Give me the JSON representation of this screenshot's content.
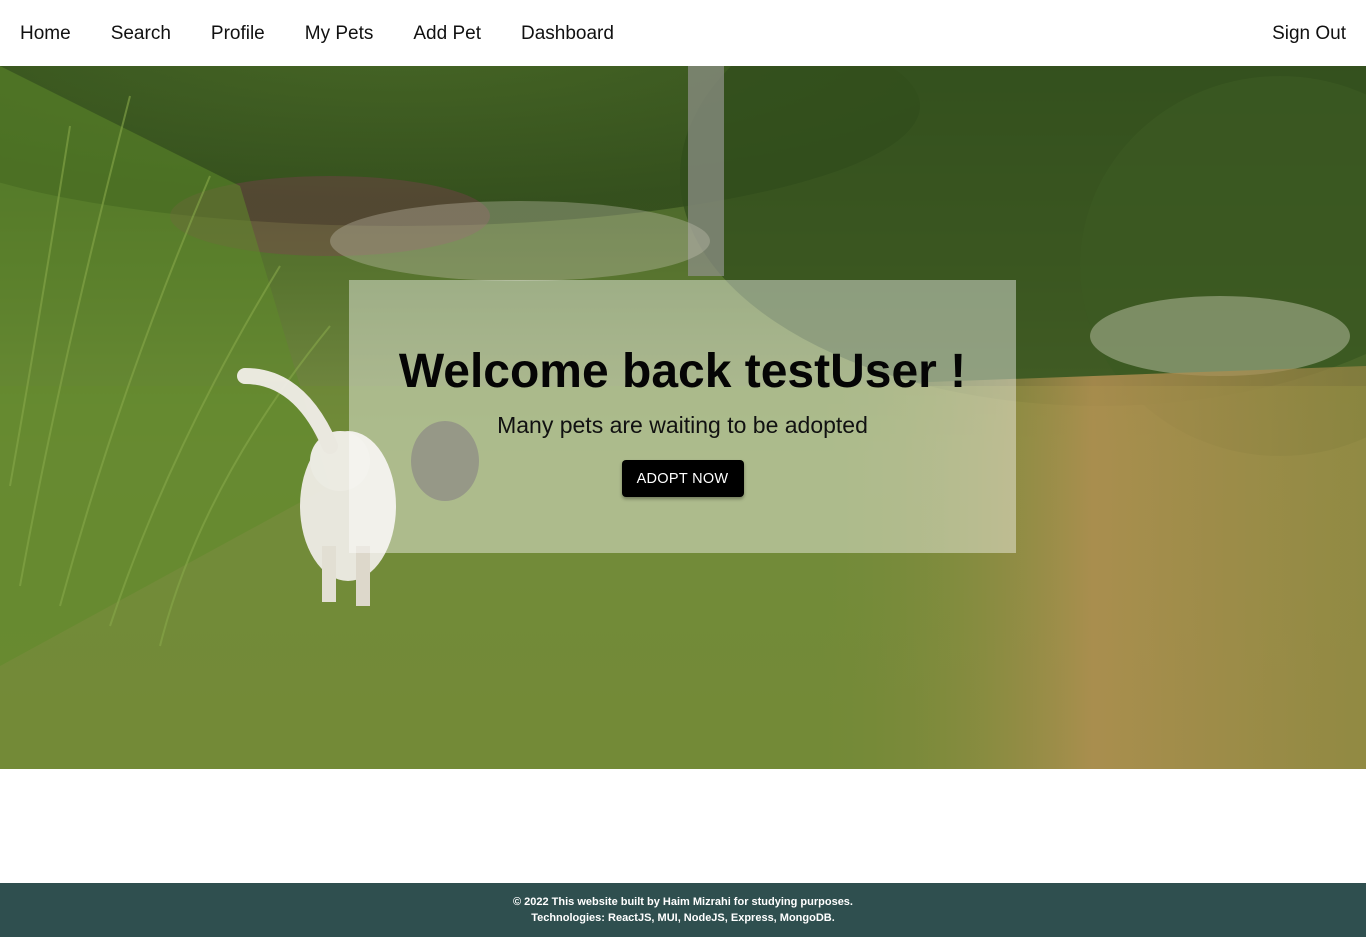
{
  "nav": {
    "links": [
      {
        "label": "Home"
      },
      {
        "label": "Search"
      },
      {
        "label": "Profile"
      },
      {
        "label": "My Pets"
      },
      {
        "label": "Add Pet"
      },
      {
        "label": "Dashboard"
      }
    ],
    "sign_out": "Sign Out"
  },
  "hero": {
    "title": "Welcome back testUser !",
    "subtitle": "Many pets are waiting to be adopted",
    "button_label": "ADOPT NOW"
  },
  "footer": {
    "line1": "© 2022 This website built by Haim Mizrahi for studying purposes.",
    "line2": "Technologies: ReactJS, MUI, NodeJS, Express, MongoDB."
  },
  "colors": {
    "footer_bg": "#2f4f4f",
    "button_bg": "#000000",
    "nav_bg": "#ffffff"
  }
}
